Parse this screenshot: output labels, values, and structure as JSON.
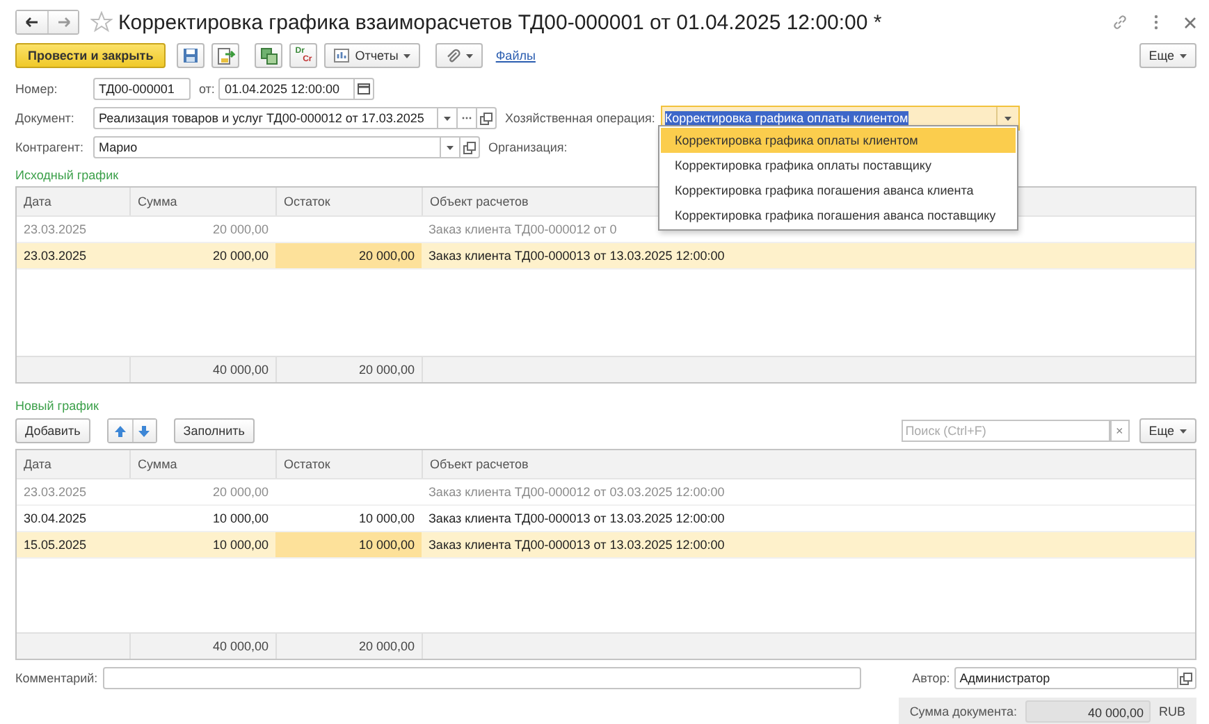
{
  "window": {
    "title": "Корректировка графика взаиморасчетов ТД00-000001 от 01.04.2025 12:00:00 *",
    "favorite": false
  },
  "toolbar": {
    "primary": "Провести и закрыть",
    "dr": "Dr",
    "cr": "Cr",
    "reports": "Отчеты",
    "files": "Файлы",
    "more": "Еще"
  },
  "fields": {
    "number": {
      "label": "Номер:",
      "value": "ТД00-000001"
    },
    "date": {
      "label": "от:",
      "value": "01.04.2025 12:00:00"
    },
    "document": {
      "label": "Документ:",
      "value": "Реализация товаров и услуг ТД00-000012 от 17.03.2025"
    },
    "counterparty": {
      "label": "Контрагент:",
      "value": "Марио"
    },
    "operation": {
      "label": "Хозяйственная операция:",
      "value": "Корректировка графика оплаты клиентом",
      "focused": true
    },
    "organization": {
      "label": "Организация:"
    }
  },
  "dropdown": {
    "options": [
      {
        "label": "Корректировка графика оплаты клиентом",
        "selected": true
      },
      {
        "label": "Корректировка графика оплаты поставщику",
        "selected": false
      },
      {
        "label": "Корректировка графика погашения аванса клиента",
        "selected": false
      },
      {
        "label": "Корректировка графика погашения аванса поставщику",
        "selected": false
      }
    ]
  },
  "original_schedule": {
    "title": "Исходный график",
    "columns": [
      "Дата",
      "Сумма",
      "Остаток",
      "Объект расчетов"
    ],
    "rows": [
      {
        "date": "23.03.2025",
        "sum": "20 000,00",
        "remainder": "",
        "object": "Заказ клиента ТД00-000012 от 0",
        "muted": true,
        "selected": false
      },
      {
        "date": "23.03.2025",
        "sum": "20 000,00",
        "remainder": "20 000,00",
        "object": "Заказ клиента ТД00-000013 от 13.03.2025 12:00:00",
        "muted": false,
        "selected": true
      }
    ],
    "totals": {
      "sum": "40 000,00",
      "remainder": "20 000,00"
    }
  },
  "new_schedule": {
    "title": "Новый график",
    "add": "Добавить",
    "fill": "Заполнить",
    "search": {
      "placeholder": "Поиск (Ctrl+F)"
    },
    "clear": "×",
    "more": "Еще",
    "columns": [
      "Дата",
      "Сумма",
      "Остаток",
      "Объект расчетов"
    ],
    "rows": [
      {
        "date": "23.03.2025",
        "sum": "20 000,00",
        "remainder": "",
        "object": "Заказ клиента ТД00-000012 от 03.03.2025 12:00:00",
        "muted": true,
        "selected": false
      },
      {
        "date": "30.04.2025",
        "sum": "10 000,00",
        "remainder": "10 000,00",
        "object": "Заказ клиента ТД00-000013 от 13.03.2025 12:00:00",
        "muted": false,
        "selected": false
      },
      {
        "date": "15.05.2025",
        "sum": "10 000,00",
        "remainder": "10 000,00",
        "object": "Заказ клиента ТД00-000013 от 13.03.2025 12:00:00",
        "muted": false,
        "selected": true
      }
    ],
    "totals": {
      "sum": "40 000,00",
      "remainder": "20 000,00"
    }
  },
  "footer": {
    "comment": {
      "label": "Комментарий:"
    },
    "author": {
      "label": "Автор:",
      "value": "Администратор"
    },
    "total": {
      "label": "Сумма документа:",
      "value": "40 000,00",
      "currency": "RUB"
    }
  }
}
